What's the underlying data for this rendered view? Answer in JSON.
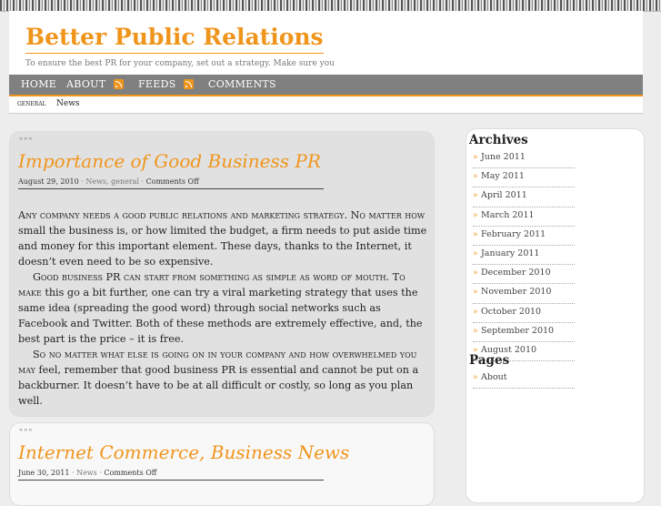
{
  "site": {
    "title": "Better Public Relations",
    "tagline": "To ensure the best PR for your company, set out a strategy. Make sure you"
  },
  "nav": {
    "home": "HOME",
    "about": "ABOUT",
    "feeds": "FEEDS",
    "comments": "COMMENTS"
  },
  "categories": [
    "general",
    "News"
  ],
  "posts": [
    {
      "title": "Importance of Good Business PR",
      "date": "August 29, 2010",
      "cats": "News, general",
      "comments": "Comments Off",
      "paragraphs": [
        {
          "lead": "Any company needs a good public relations and marketing strategy.  No matter how",
          "rest": "small the business is, or how limited the budget, a firm needs to put aside time and money for this important element.  These days, thanks to the Internet, it doesn’t even need to be so expensive."
        },
        {
          "lead": "Good business PR can start from something as simple as word of mouth.  To make",
          "rest": "this go a bit further, one can try a viral marketing strategy that uses the same idea (spreading the good word) through social networks such as Facebook and Twitter.  Both of these methods are extremely effective, and, the best part is the price – it is free."
        },
        {
          "lead": "So no matter what else is going on in your company and how overwhelmed you may",
          "rest": "feel, remember that good business PR is essential and cannot be put on a backburner.  It doesn’t have to be at all difficult or costly, so long as you plan well."
        }
      ]
    },
    {
      "title": "Internet Commerce, Business News",
      "date": "June 30, 2011",
      "cats": "News",
      "comments": "Comments Off"
    }
  ],
  "sidebar": {
    "archives_heading": "Archives",
    "archives": [
      "June 2011",
      "May 2011",
      "April 2011",
      "March 2011",
      "February 2011",
      "January 2011",
      "December 2010",
      "November 2010",
      "October 2010",
      "September 2010",
      "August 2010"
    ],
    "pages_heading": "Pages",
    "pages": [
      "About"
    ]
  },
  "decor": {
    "quote_mark": "\"\"\"",
    "meta_sep": " · "
  },
  "colors": {
    "accent": "#f0951c",
    "nav_bg": "#808080",
    "post_bg": "#e1e1e1"
  }
}
